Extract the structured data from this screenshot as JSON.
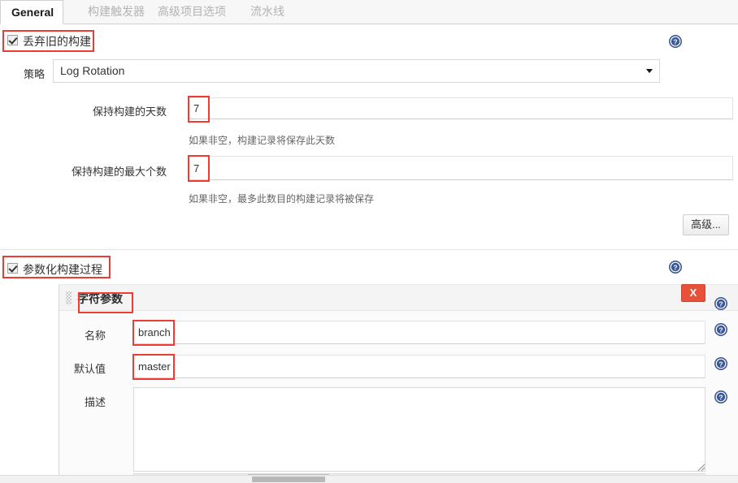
{
  "tabs": [
    {
      "label": "General",
      "active": true
    },
    {
      "label": "构建触发器",
      "active": false
    },
    {
      "label": "高级项目选项",
      "active": false
    },
    {
      "label": "流水线",
      "active": false
    }
  ],
  "discard": {
    "checkbox_label": "丢弃旧的构建",
    "checked": true,
    "strategy_label": "策略",
    "strategy_value": "Log Rotation",
    "days_label": "保持构建的天数",
    "days_value": "7",
    "days_help": "如果非空，构建记录将保存此天数",
    "max_label": "保持构建的最大个数",
    "max_value": "7",
    "max_help": "如果非空，最多此数目的构建记录将被保存",
    "advanced_button": "高级..."
  },
  "parameterized": {
    "checkbox_label": "参数化构建过程",
    "checked": true,
    "param": {
      "title": "字符参数",
      "delete_label": "X",
      "name_label": "名称",
      "name_value": "branch",
      "default_label": "默认值",
      "default_value": "master",
      "description_label": "描述",
      "description_value": ""
    }
  },
  "icons": {
    "help": "?",
    "dropdown": "chevron-down"
  },
  "colors": {
    "annotation": "#ee3b33",
    "delete_button": "#e8503a",
    "help_icon": "#3b5998"
  }
}
